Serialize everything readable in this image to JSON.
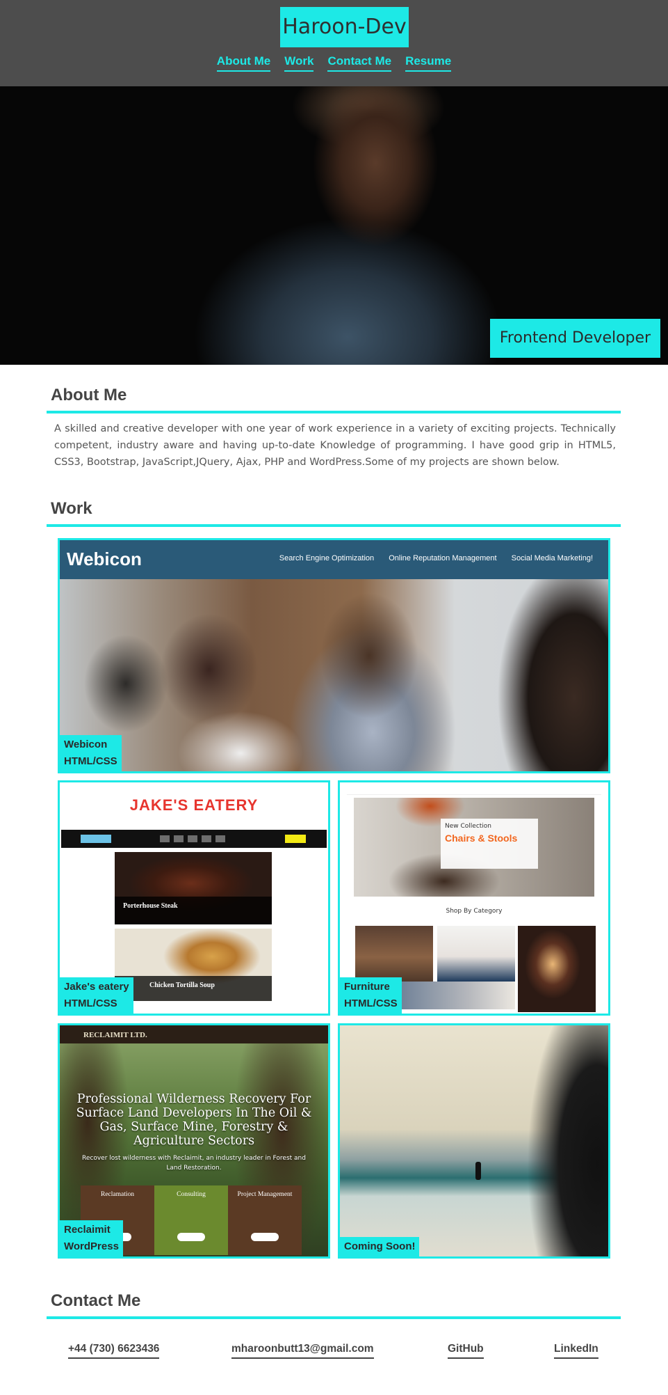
{
  "header": {
    "logo": "Haroon-Dev",
    "nav": [
      "About Me",
      "Work",
      "Contact Me",
      "Resume"
    ],
    "accent": "#1de9e6",
    "background": "#4d4d4d"
  },
  "hero": {
    "badge": "Frontend Developer"
  },
  "about": {
    "title": "About Me",
    "text": "A skilled and creative developer with one year of work experience in a variety of exciting projects. Technically competent, industry aware and having up-to-date Knowledge of programming. I have good grip in HTML5, CSS3, Bootstrap, JavaScript,JQuery, Ajax, PHP and WordPress.Some of my projects are shown below."
  },
  "work": {
    "title": "Work",
    "projects": [
      {
        "name": "Webicon",
        "tech": "HTML/CSS",
        "preview": {
          "brand": "Webicon",
          "nav": [
            "Search Engine Optimization",
            "Online Reputation Management",
            "Social Media Marketing!"
          ]
        }
      },
      {
        "name": "Jake's eatery",
        "tech": "HTML/CSS",
        "preview": {
          "brand": "JAKE'S EATERY",
          "item1": "Porterhouse Steak",
          "item2": "Chicken Tortilla Soup"
        }
      },
      {
        "name": "Furniture",
        "tech": "HTML/CSS",
        "preview": {
          "eyebrow": "New Collection",
          "headline": "Chairs & Stools",
          "category": "Shop By Category"
        }
      },
      {
        "name": "Reclaimit",
        "tech": "WordPress",
        "preview": {
          "brand": "RECLAIMIT LTD.",
          "headline": "Professional Wilderness Recovery For Surface Land Developers In The Oil & Gas, Surface Mine, Forestry & Agriculture Sectors",
          "sub": "Recover lost wilderness with Reclaimit, an industry leader in Forest and Land Restoration.",
          "boxes": [
            "Reclamation",
            "Consulting",
            "Project Management"
          ]
        }
      },
      {
        "name": "Coming Soon!",
        "tech": ""
      }
    ]
  },
  "contact": {
    "title": "Contact Me",
    "phone": "+44 (730) 6623436",
    "email": "mharoonbutt13@gmail.com",
    "github": "GitHub",
    "linkedin": "LinkedIn"
  }
}
